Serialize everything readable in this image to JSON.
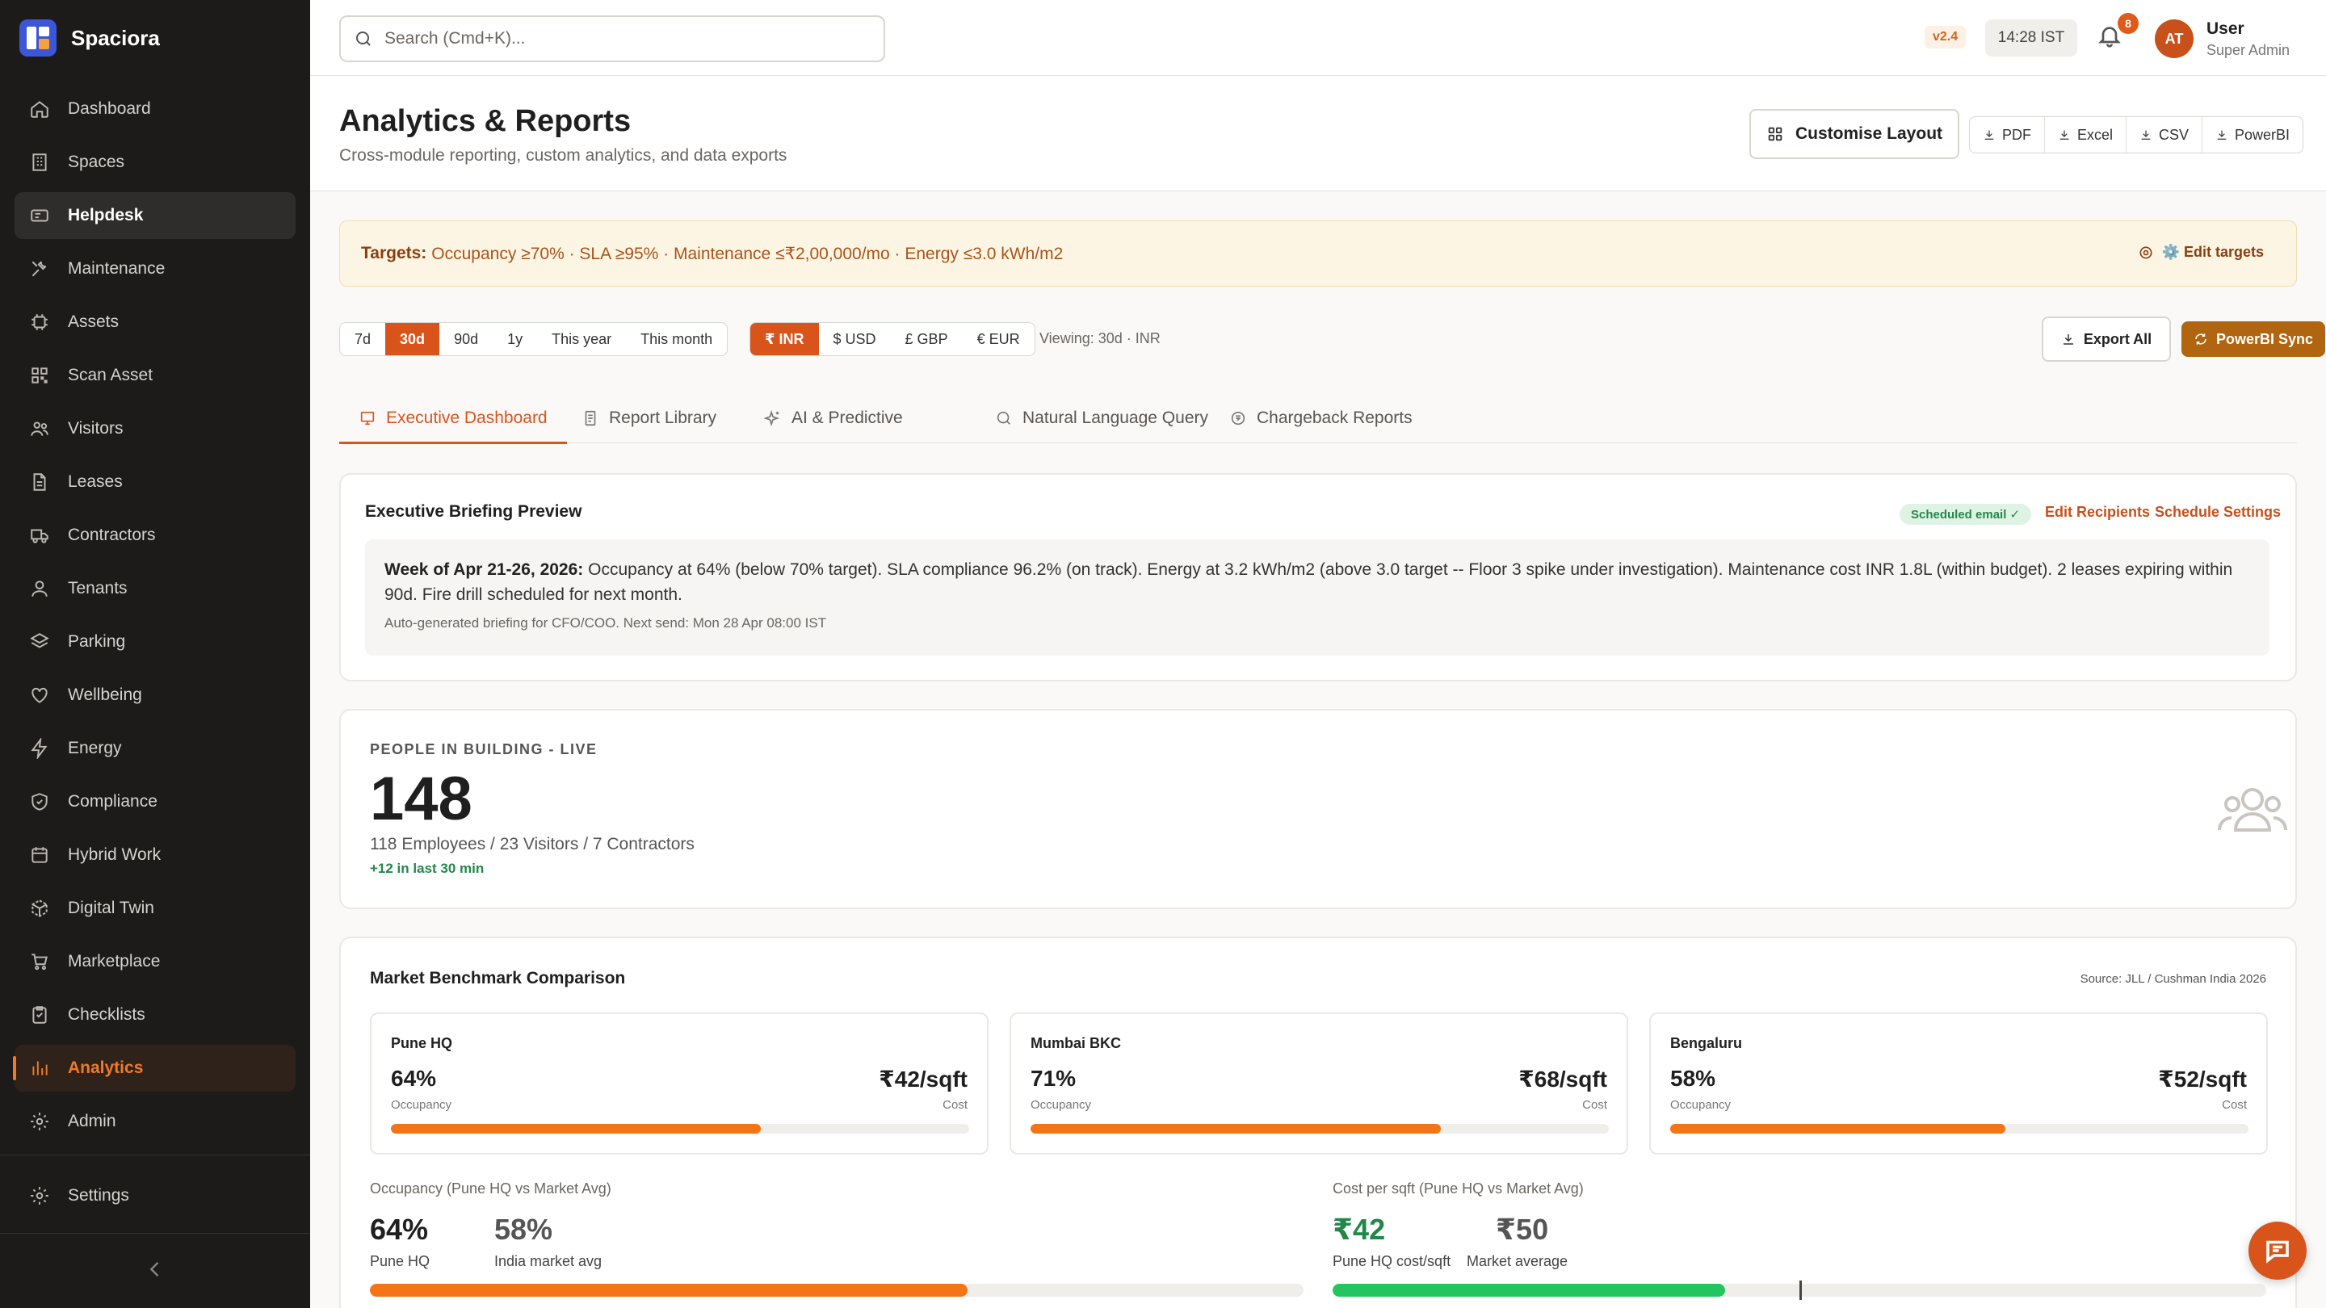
{
  "app": {
    "name": "Spaciora",
    "version": "v2.4",
    "time": "14:28 IST",
    "notifications": "8"
  },
  "user": {
    "initials": "AT",
    "name": "User",
    "role": "Super Admin"
  },
  "search": {
    "placeholder": "Search (Cmd+K)..."
  },
  "sidebar": {
    "items": [
      {
        "label": "Dashboard",
        "icon": "home-icon"
      },
      {
        "label": "Spaces",
        "icon": "building-icon"
      },
      {
        "label": "Helpdesk",
        "icon": "ticket-icon"
      },
      {
        "label": "Maintenance",
        "icon": "wrench-icon"
      },
      {
        "label": "Assets",
        "icon": "chip-icon"
      },
      {
        "label": "Scan Asset",
        "icon": "qr-icon"
      },
      {
        "label": "Visitors",
        "icon": "users-icon"
      },
      {
        "label": "Leases",
        "icon": "document-icon"
      },
      {
        "label": "Contractors",
        "icon": "truck-icon"
      },
      {
        "label": "Tenants",
        "icon": "person-icon"
      },
      {
        "label": "Parking",
        "icon": "layers-icon"
      },
      {
        "label": "Wellbeing",
        "icon": "heart-icon"
      },
      {
        "label": "Energy",
        "icon": "bolt-icon"
      },
      {
        "label": "Compliance",
        "icon": "shield-icon"
      },
      {
        "label": "Hybrid Work",
        "icon": "calendar-icon"
      },
      {
        "label": "Digital Twin",
        "icon": "cube-icon"
      },
      {
        "label": "Marketplace",
        "icon": "cart-icon"
      },
      {
        "label": "Checklists",
        "icon": "clipboard-icon"
      },
      {
        "label": "Analytics",
        "icon": "bar-chart-icon"
      },
      {
        "label": "Admin",
        "icon": "gear-icon"
      }
    ],
    "settings": "Settings"
  },
  "header": {
    "title": "Analytics & Reports",
    "subtitle": "Cross-module reporting, custom analytics, and data exports",
    "customise": "Customise Layout",
    "exports": [
      "PDF",
      "Excel",
      "CSV",
      "PowerBI"
    ]
  },
  "targets": {
    "label": "Targets:",
    "text": "Occupancy ≥70% · SLA ≥95% · Maintenance ≤₹2,00,000/mo · Energy ≤3.0 kWh/m2",
    "edit": "⚙️ Edit targets"
  },
  "filters": {
    "periods": [
      "7d",
      "30d",
      "90d",
      "1y",
      "This year",
      "This month"
    ],
    "period_selected": "30d",
    "currencies": [
      "₹ INR",
      "$ USD",
      "£ GBP",
      "€ EUR"
    ],
    "currency_selected": "₹ INR",
    "viewing": "Viewing: 30d · INR",
    "export_all": "Export All",
    "powerbi_sync": "PowerBI Sync"
  },
  "tabs": [
    {
      "label": "Executive Dashboard",
      "icon": "monitor-icon"
    },
    {
      "label": "Report Library",
      "icon": "files-icon"
    },
    {
      "label": "AI & Predictive",
      "icon": "sparkle-icon"
    },
    {
      "label": "Natural Language Query",
      "icon": "search-icon"
    },
    {
      "label": "Chargeback Reports",
      "icon": "coin-icon"
    }
  ],
  "briefing": {
    "title": "Executive Briefing Preview",
    "badge": "Scheduled email ✓",
    "edit_recipients": "Edit Recipients",
    "schedule_settings": "Schedule Settings",
    "week": "Week of Apr 21-26, 2026:",
    "body": "Occupancy at 64% (below 70% target). SLA compliance 96.2% (on track). Energy at 3.2 kWh/m2 (above 3.0 target -- Floor 3 spike under investigation). Maintenance cost INR 1.8L (within budget). 2 leases expiring within 90d. Fire drill scheduled for next month.",
    "footer": "Auto-generated briefing for CFO/COO. Next send: Mon 28 Apr 08:00 IST"
  },
  "people": {
    "label": "PEOPLE IN BUILDING - LIVE",
    "count": "148",
    "breakdown": "118 Employees / 23 Visitors / 7 Contractors",
    "delta": "+12 in last 30 min"
  },
  "benchmark": {
    "title": "Market Benchmark Comparison",
    "source": "Source: JLL / Cushman India 2026",
    "occupancy_label": "Occupancy",
    "cost_label": "Cost",
    "cities": [
      {
        "name": "Pune HQ",
        "occupancy": "64%",
        "cost": "₹42/sqft",
        "occupancy_fraction": 0.64
      },
      {
        "name": "Mumbai BKC",
        "occupancy": "71%",
        "cost": "₹68/sqft",
        "occupancy_fraction": 0.71
      },
      {
        "name": "Bengaluru",
        "occupancy": "58%",
        "cost": "₹52/sqft",
        "occupancy_fraction": 0.58
      }
    ],
    "occupancy_compare": {
      "label": "Occupancy (Pune HQ vs Market Avg)",
      "primary": "64%",
      "primary_label": "Pune HQ",
      "secondary": "58%",
      "secondary_label": "India market avg",
      "fill_fraction": 0.64
    },
    "cost_compare": {
      "label": "Cost per sqft (Pune HQ vs Market Avg)",
      "primary": "₹42",
      "primary_label": "Pune HQ cost/sqft",
      "secondary": "₹50",
      "secondary_label": "Market average",
      "fill_fraction": 0.42,
      "marker_fraction": 0.5
    }
  },
  "colors": {
    "accent": "#d9541b",
    "sidebar": "#1c1b1a",
    "success": "#24874a",
    "bar": "#f47416",
    "green_bar": "#22c55e"
  }
}
